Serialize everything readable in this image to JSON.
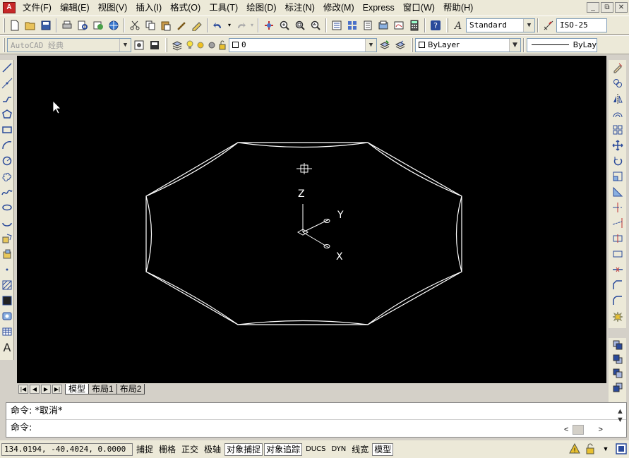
{
  "menu": {
    "items": [
      "文件(F)",
      "编辑(E)",
      "视图(V)",
      "插入(I)",
      "格式(O)",
      "工具(T)",
      "绘图(D)",
      "标注(N)",
      "修改(M)",
      "Express",
      "窗口(W)",
      "帮助(H)"
    ]
  },
  "window_controls": {
    "minimize": "_",
    "restore": "⧉",
    "close": "✕"
  },
  "toolbar_std": {
    "text_style": "Standard",
    "dim_style": "ISO-25"
  },
  "toolbar_layers": {
    "workspace": "AutoCAD 经典",
    "layer": "0",
    "color": "ByLayer",
    "linetype": "ByLay"
  },
  "axes": {
    "z": "Z",
    "y": "Y",
    "x": "X"
  },
  "tabs": {
    "nav": [
      "|◀",
      "◀",
      "▶",
      "▶|"
    ],
    "items": [
      "模型",
      "布局1",
      "布局2"
    ]
  },
  "command": {
    "history": "命令: *取消*",
    "prompt": "命令:"
  },
  "status": {
    "coords": "134.0194,  -40.4024, 0.0000",
    "buttons": [
      "捕捉",
      "栅格",
      "正交",
      "极轴",
      "对象捕捉",
      "对象追踪",
      "DUCS",
      "DYN",
      "线宽",
      "模型"
    ],
    "on": [
      "对象捕捉",
      "对象追踪",
      "模型"
    ]
  },
  "colors": {
    "canvas": "#000000",
    "geometry": "#ffffff",
    "chrome": "#ece9d8"
  }
}
